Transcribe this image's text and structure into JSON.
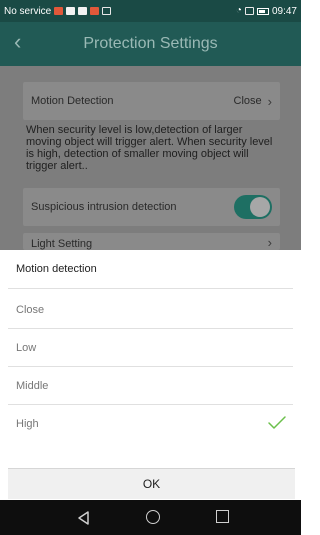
{
  "status_bar": {
    "carrier": "No service",
    "time": "09:47",
    "left_icons": [
      "notification-red-icon",
      "mail-icon",
      "record-icon",
      "notification-red-icon",
      "image-icon"
    ],
    "right_icons": [
      "wifi-icon",
      "sim-icon",
      "battery-icon"
    ]
  },
  "header": {
    "title": "Protection Settings",
    "back_icon": "chevron-left-icon"
  },
  "settings": {
    "motion_detection": {
      "label": "Motion Detection",
      "value": "Close"
    },
    "description": "When security level is low,detection of larger moving object will trigger alert. When security level is high, detection of smaller moving object will trigger alert..",
    "suspicious_intrusion": {
      "label": "Suspicious intrusion detection",
      "enabled": true
    },
    "light_setting": {
      "label": "Light Setting"
    }
  },
  "dialog": {
    "title": "Motion detection",
    "options": [
      "Close",
      "Low",
      "Middle",
      "High"
    ],
    "selected": "High",
    "ok_label": "OK"
  },
  "nav_bar": {
    "icons": [
      "back-triangle-icon",
      "home-circle-icon",
      "recent-square-icon"
    ]
  },
  "colors": {
    "header": "#215a55",
    "status_bar": "#1a4a45",
    "dim_overlay": "#7d7d7d",
    "toggle_on": "#1e6f63",
    "check": "#6bc04b"
  }
}
